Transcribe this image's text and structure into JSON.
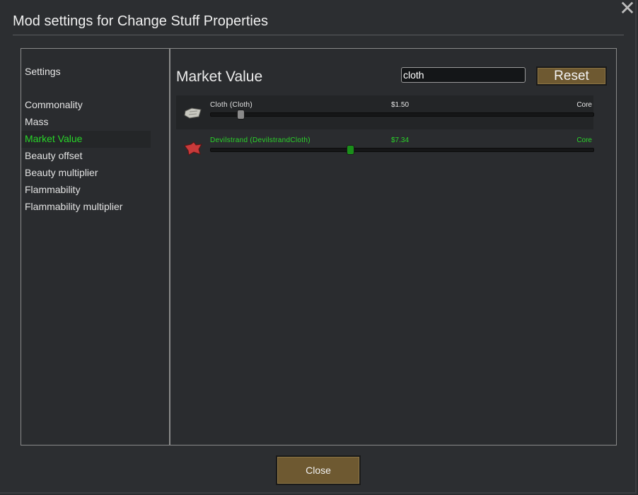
{
  "window": {
    "title": "Mod settings for Change Stuff Properties",
    "close_icon": "close-icon"
  },
  "sidebar": {
    "heading": "Settings",
    "items": [
      {
        "label": "Commonality",
        "active": false
      },
      {
        "label": "Mass",
        "active": false
      },
      {
        "label": "Market Value",
        "active": true
      },
      {
        "label": "Beauty offset",
        "active": false
      },
      {
        "label": "Beauty multiplier",
        "active": false
      },
      {
        "label": "Flammability",
        "active": false
      },
      {
        "label": "Flammability multiplier",
        "active": false
      }
    ]
  },
  "main": {
    "section_title": "Market Value",
    "search": {
      "value": "cloth",
      "placeholder": ""
    },
    "reset_label": "Reset",
    "rows": [
      {
        "name": "Cloth (Cloth)",
        "value": "$1.50",
        "source": "Core",
        "slider_fraction": 0.078,
        "icon": "cloth-icon",
        "icon_color": "#c8c8c0",
        "highlight": false
      },
      {
        "name": "Devilstrand (DevilstrandCloth)",
        "value": "$7.34",
        "source": "Core",
        "slider_fraction": 0.365,
        "icon": "devilstrand-icon",
        "icon_color": "#c83a3a",
        "highlight": true
      }
    ]
  },
  "footer": {
    "close_label": "Close"
  },
  "colors": {
    "accent_green": "#2ad42a",
    "button_brown": "#6e5931"
  }
}
